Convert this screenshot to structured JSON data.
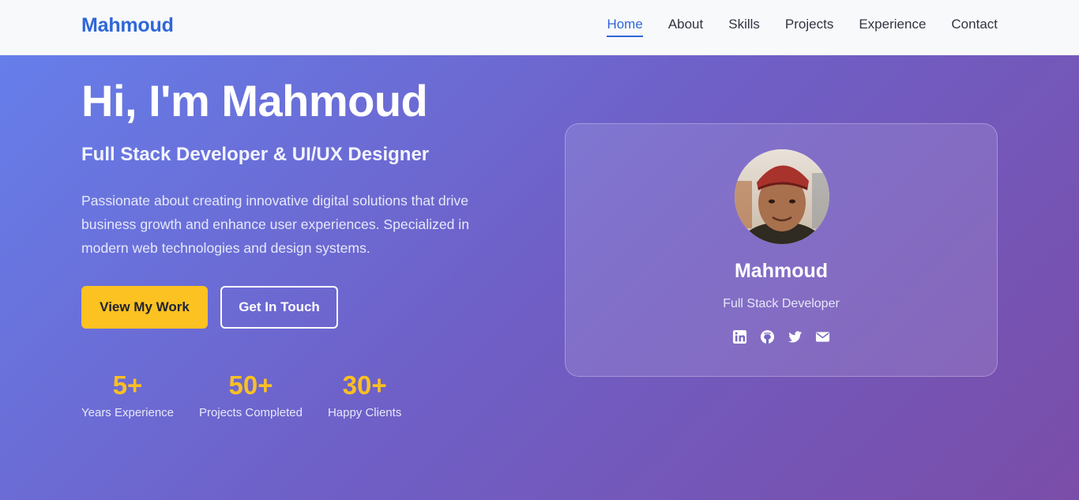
{
  "nav": {
    "brand": "Mahmoud",
    "links": [
      "Home",
      "About",
      "Skills",
      "Projects",
      "Experience",
      "Contact"
    ],
    "active": "Home"
  },
  "hero": {
    "title": "Hi, I'm Mahmoud",
    "subtitle": "Full Stack Developer & UI/UX Designer",
    "description": "Passionate about creating innovative digital solutions that drive business growth and enhance user experiences. Specialized in modern web technologies and design systems.",
    "primary_button": "View My Work",
    "secondary_button": "Get In Touch",
    "stats": [
      {
        "value": "5+",
        "label": "Years Experience"
      },
      {
        "value": "50+",
        "label": "Projects Completed"
      },
      {
        "value": "30+",
        "label": "Happy Clients"
      }
    ]
  },
  "card": {
    "name": "Mahmoud",
    "role": "Full Stack Developer",
    "socials": [
      "linkedin-icon",
      "github-icon",
      "twitter-icon",
      "email-icon"
    ]
  },
  "colors": {
    "brand": "#2f67d8",
    "accent": "#fbbf24",
    "hero_gradient_start": "#667eea",
    "hero_gradient_end": "#7a4da8"
  }
}
